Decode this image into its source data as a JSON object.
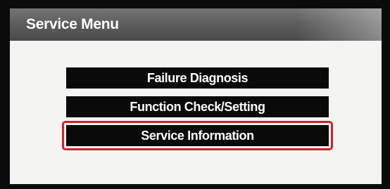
{
  "screen": {
    "title": "Service Menu"
  },
  "menu": {
    "items": [
      {
        "label": "Failure Diagnosis"
      },
      {
        "label": "Function Check/Setting"
      },
      {
        "label": "Service Information",
        "highlighted": true
      }
    ],
    "highlight_color": "#d4202a"
  }
}
